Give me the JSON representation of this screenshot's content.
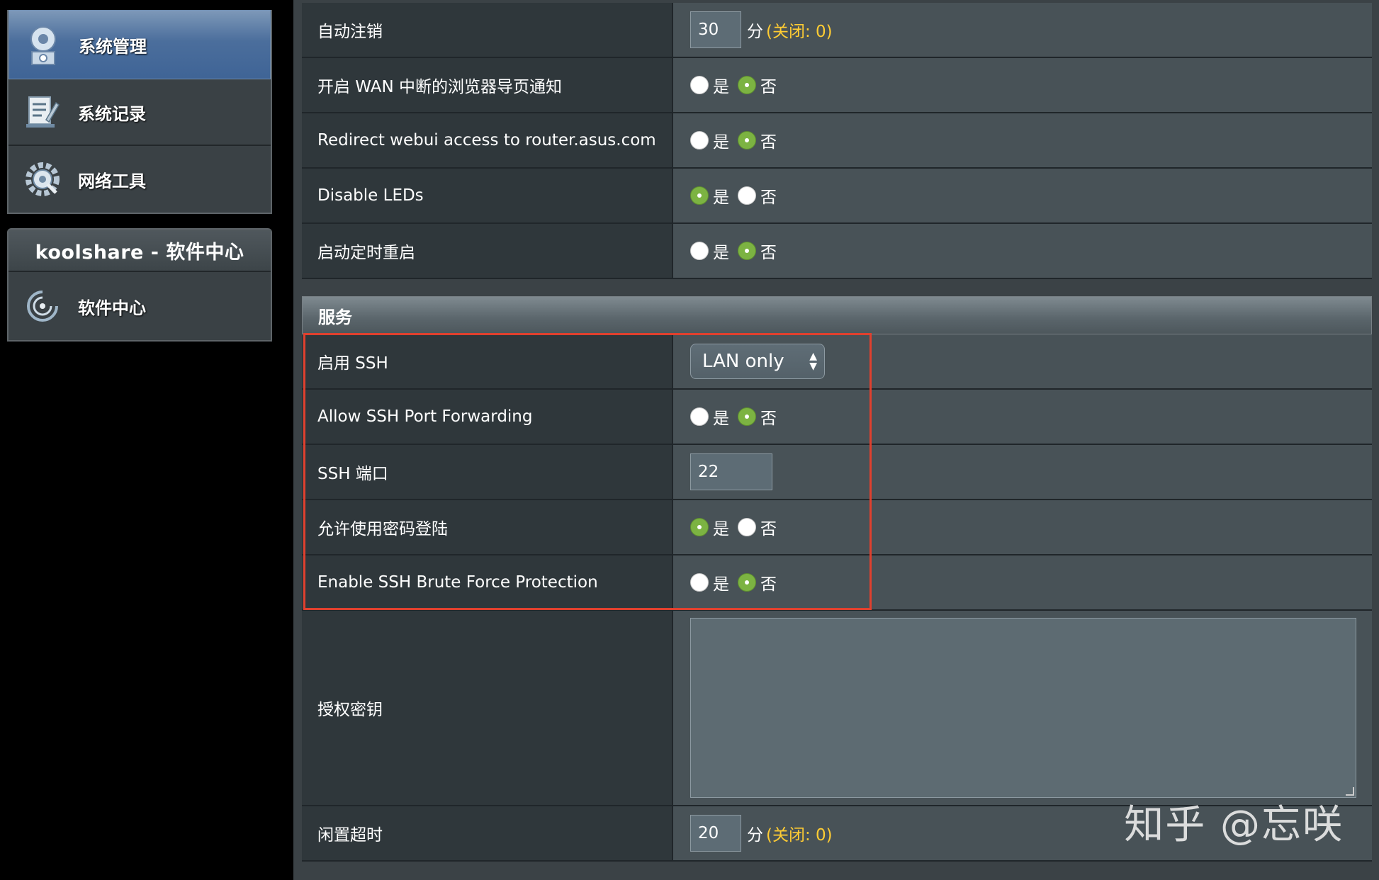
{
  "sidebar": {
    "items": [
      {
        "label": "系统管理",
        "icon": "gear-user-icon",
        "active": true
      },
      {
        "label": "系统记录",
        "icon": "log-icon",
        "active": false
      },
      {
        "label": "网络工具",
        "icon": "network-tools-icon",
        "active": false
      }
    ],
    "koolshare": {
      "header": "koolshare - 软件中心",
      "item": {
        "label": "软件中心",
        "icon": "software-center-icon"
      }
    }
  },
  "settings_top": {
    "auto_logout": {
      "label": "自动注销",
      "value": "30",
      "unit": "分",
      "note": "(关闭: 0)"
    },
    "wan_notify": {
      "label": "开启 WAN 中断的浏览器导页通知",
      "yes": "是",
      "no": "否",
      "selected": "no"
    },
    "redirect": {
      "label": "Redirect webui access to router.asus.com",
      "yes": "是",
      "no": "否",
      "selected": "no"
    },
    "disable_leds": {
      "label": "Disable LEDs",
      "yes": "是",
      "no": "否",
      "selected": "yes"
    },
    "scheduled_reboot": {
      "label": "启动定时重启",
      "yes": "是",
      "no": "否",
      "selected": "no"
    }
  },
  "services": {
    "header": "服务",
    "enable_ssh": {
      "label": "启用 SSH",
      "value": "LAN only"
    },
    "ssh_port_forwarding": {
      "label": "Allow SSH Port Forwarding",
      "yes": "是",
      "no": "否",
      "selected": "no"
    },
    "ssh_port": {
      "label": "SSH 端口",
      "value": "22"
    },
    "password_login": {
      "label": "允许使用密码登陆",
      "yes": "是",
      "no": "否",
      "selected": "yes"
    },
    "brute_force": {
      "label": "Enable SSH Brute Force Protection",
      "yes": "是",
      "no": "否",
      "selected": "no"
    },
    "auth_key": {
      "label": "授权密钥",
      "value": ""
    },
    "idle_timeout": {
      "label": "闲置超时",
      "value": "20",
      "unit": "分",
      "note": "(关闭: 0)"
    }
  },
  "watermark": "知乎 @忘咲",
  "colors": {
    "highlight": "#e0402e",
    "radio_on": "#7cb342",
    "note": "#ffcc33"
  }
}
